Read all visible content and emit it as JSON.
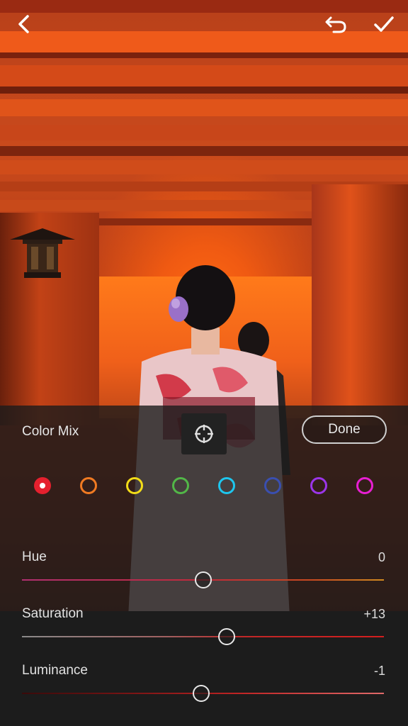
{
  "header": {
    "back_icon": "chevron-left-icon",
    "undo_icon": "undo-icon",
    "confirm_icon": "checkmark-icon"
  },
  "panel": {
    "title": "Color Mix",
    "target_icon": "targeted-adjustment-icon",
    "done_label": "Done"
  },
  "colors": [
    {
      "name": "red",
      "hex": "#e5202e",
      "selected": true
    },
    {
      "name": "orange",
      "hex": "#f07a22",
      "selected": false
    },
    {
      "name": "yellow",
      "hex": "#f2dc18",
      "selected": false
    },
    {
      "name": "green",
      "hex": "#52b748",
      "selected": false
    },
    {
      "name": "aqua",
      "hex": "#1ec6ee",
      "selected": false
    },
    {
      "name": "blue",
      "hex": "#3a4fb0",
      "selected": false
    },
    {
      "name": "purple",
      "hex": "#9b35e8",
      "selected": false
    },
    {
      "name": "magenta",
      "hex": "#e81fd2",
      "selected": false
    }
  ],
  "sliders": {
    "hue": {
      "label": "Hue",
      "value": "0",
      "position": 0.5
    },
    "saturation": {
      "label": "Saturation",
      "value": "+13",
      "position": 0.565
    },
    "luminance": {
      "label": "Luminance",
      "value": "-1",
      "position": 0.495
    }
  }
}
